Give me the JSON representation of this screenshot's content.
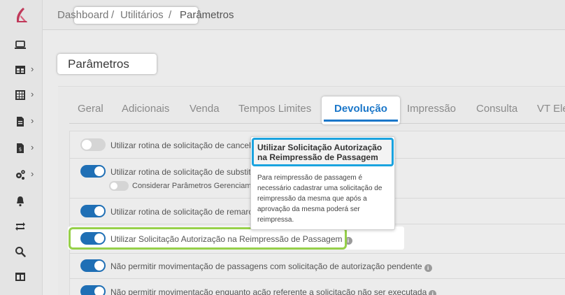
{
  "breadcrumb": {
    "home": "Dashboard",
    "sep1": "/",
    "section": "Utilitários",
    "sep2": "/",
    "current": "Parâmetros"
  },
  "page": {
    "title": "Parâmetros"
  },
  "tabs": [
    {
      "label": "Geral"
    },
    {
      "label": "Adicionais"
    },
    {
      "label": "Venda"
    },
    {
      "label": "Tempos Limites"
    },
    {
      "label": "Devolução",
      "active": true
    },
    {
      "label": "Impressão"
    },
    {
      "label": "Consulta"
    },
    {
      "label": "VT Ele"
    }
  ],
  "settings": [
    {
      "label": "Utilizar rotina de solicitação de cancelam",
      "on": false
    },
    {
      "label": "Utilizar rotina de solicitação de substitui",
      "on": true
    },
    {
      "label": "Considerar Parâmetros Gerenciame",
      "on": false
    },
    {
      "label": "Utilizar rotina de solicitação de remarcaç",
      "on": true
    },
    {
      "label": "Utilizar Solicitação Autorização na Reimpressão de Passagem",
      "on": true
    },
    {
      "label": "Não permitir movimentação de passagens com solicitação de autorização pendente",
      "on": true
    },
    {
      "label": "Não permitir movimentação enquanto ação referente a solicitação não ser executada",
      "on": true
    }
  ],
  "tooltip": {
    "title": "Utilizar Solicitação Autorização na Reimpressão de Passagem",
    "body": "Para reimpressão de passagem é necessário cadastrar uma solicitação de reimpressão da mesma que após a aprovação da mesma poderá ser reimpressa."
  },
  "info_glyph": "i",
  "sidebar": {
    "items": [
      {
        "icon": "laptop-icon"
      },
      {
        "icon": "table-icon"
      },
      {
        "icon": "grid-icon"
      },
      {
        "icon": "document-icon"
      },
      {
        "icon": "invoice-icon"
      },
      {
        "icon": "gears-icon"
      },
      {
        "icon": "bell-icon"
      },
      {
        "icon": "sync-icon"
      },
      {
        "icon": "search-icon"
      },
      {
        "icon": "columns-icon"
      }
    ],
    "chevron": "›"
  },
  "colors": {
    "accent": "#1b77c9",
    "toggle_on": "#1f6fb5",
    "highlight_green": "#96d04a",
    "highlight_blue": "#1aa3df",
    "brand": "#c0395a"
  }
}
